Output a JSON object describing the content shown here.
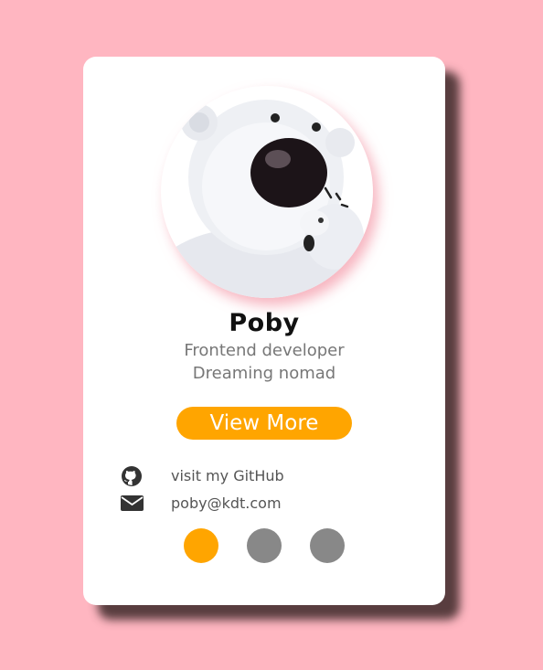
{
  "profile": {
    "name": "Poby",
    "role_line1": "Frontend developer",
    "role_line2": "Dreaming nomad",
    "view_more_label": "View More",
    "avatar_icon": "polar-bear-avatar"
  },
  "contacts": [
    {
      "icon": "github-icon",
      "label": "visit my GitHub"
    },
    {
      "icon": "envelope-icon",
      "label": "poby@kdt.com"
    }
  ],
  "pagination": {
    "active_index": 0,
    "count": 3
  },
  "colors": {
    "background": "#ffb6c1",
    "accent": "#ffa500",
    "dot_inactive": "#888888",
    "card": "#ffffff"
  }
}
